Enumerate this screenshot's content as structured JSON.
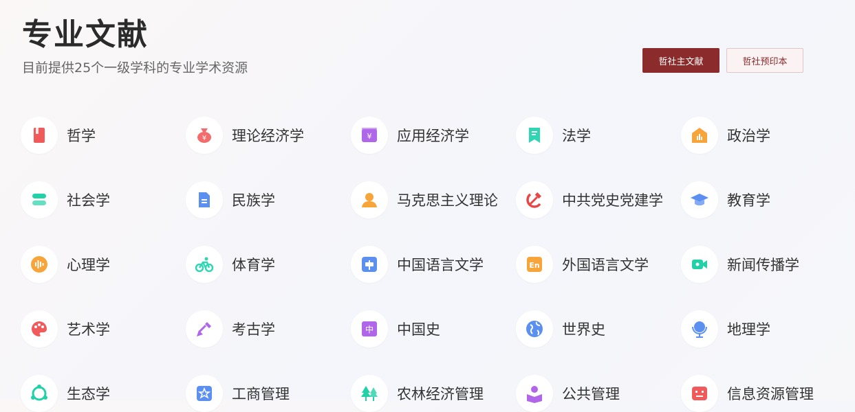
{
  "header": {
    "title": "专业文献",
    "subtitle": "目前提供25个一级学科的专业学术资源"
  },
  "buttons": {
    "primary_label": "哲社主文献",
    "secondary_label": "哲社预印本"
  },
  "subjects": [
    {
      "label": "哲学",
      "icon": "book-icon",
      "color": "#f05a5a"
    },
    {
      "label": "理论经济学",
      "icon": "money-bag-icon",
      "color": "#f36b6b"
    },
    {
      "label": "应用经济学",
      "icon": "yuan-box-icon",
      "color": "#b066e8"
    },
    {
      "label": "法学",
      "icon": "bookmark-icon",
      "color": "#2fd6b4"
    },
    {
      "label": "政治学",
      "icon": "building-chart-icon",
      "color": "#f7a53a"
    },
    {
      "label": "社会学",
      "icon": "layers-icon",
      "color": "#22d1a8"
    },
    {
      "label": "民族学",
      "icon": "document-icon",
      "color": "#5b8ff0"
    },
    {
      "label": "马克思主义理论",
      "icon": "person-icon",
      "color": "#f7a53a"
    },
    {
      "label": "中共党史党建学",
      "icon": "hammer-sickle-icon",
      "color": "#e84545"
    },
    {
      "label": "教育学",
      "icon": "graduation-cap-icon",
      "color": "#5b8ff0"
    },
    {
      "label": "心理学",
      "icon": "sound-wave-icon",
      "color": "#f7a53a"
    },
    {
      "label": "体育学",
      "icon": "bicycle-icon",
      "color": "#2fd6b4"
    },
    {
      "label": "中国语言文学",
      "icon": "chat-icon",
      "color": "#5b8ff0"
    },
    {
      "label": "外国语言文学",
      "icon": "english-icon",
      "color": "#f7a53a"
    },
    {
      "label": "新闻传播学",
      "icon": "video-camera-icon",
      "color": "#22d1a8"
    },
    {
      "label": "艺术学",
      "icon": "palette-icon",
      "color": "#f05a5a"
    },
    {
      "label": "考古学",
      "icon": "shovel-icon",
      "color": "#b066e8"
    },
    {
      "label": "中国史",
      "icon": "zhong-seal-icon",
      "color": "#b066e8"
    },
    {
      "label": "世界史",
      "icon": "globe-icon",
      "color": "#5b8ff0"
    },
    {
      "label": "地理学",
      "icon": "globe-stand-icon",
      "color": "#5b8ff0"
    },
    {
      "label": "生态学",
      "icon": "ecology-icon",
      "color": "#22d1a8"
    },
    {
      "label": "工商管理",
      "icon": "star-box-icon",
      "color": "#5b8ff0"
    },
    {
      "label": "农林经济管理",
      "icon": "trees-icon",
      "color": "#22d1a8"
    },
    {
      "label": "公共管理",
      "icon": "person-book-icon",
      "color": "#b066e8"
    },
    {
      "label": "信息资源管理",
      "icon": "info-board-icon",
      "color": "#f05a5a"
    }
  ]
}
